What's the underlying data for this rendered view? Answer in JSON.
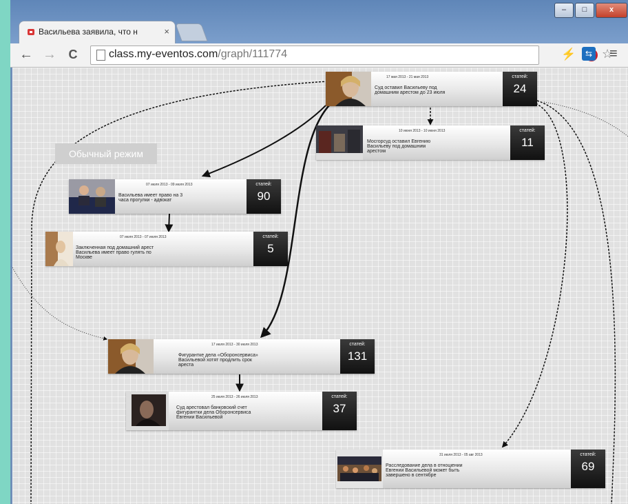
{
  "browser": {
    "tab_title": "Васильева заявила, что н",
    "tab_close": "×",
    "window_buttons": {
      "minimize": "–",
      "maximize": "□",
      "close": "x"
    },
    "nav": {
      "back": "←",
      "forward": "→",
      "reload": "C"
    },
    "url_host": "class.my-eventos.com",
    "url_path": "/graph/111774",
    "adblock_badge": "ABP",
    "star_icon": "☆",
    "ext1_icon": "⚡",
    "ext2_icon": "⇆",
    "menu_icon": "≡"
  },
  "page": {
    "mode_button": "Обычный режим",
    "count_label": "статей:",
    "nodes": [
      {
        "date": "17 мая 2013 - 21 мая 2013",
        "text": "Суд оставил Васильеву под домашним арестом до 23 июля",
        "count": "24",
        "photo": "woman-portrait"
      },
      {
        "date": "10 июня 2013 - 10 июня 2013",
        "text": "Мосгорсуд оставил Евгению Васильеву под домашним арестом",
        "count": "11",
        "photo": "court-scene"
      },
      {
        "date": "07 июля 2013 - 09 июля 2013",
        "text": "Васильева имеет право на 3 часа прогулки - адвокат",
        "count": "90",
        "photo": "courtroom-people"
      },
      {
        "date": "07 июля 2013 - 07 июля 2013",
        "text": "Заключенная под домашний арест Васильева имеет право гулять по Москве",
        "count": "5",
        "photo": "woman-doorway"
      },
      {
        "date": "17 июля 2013 - 30 июля 2013",
        "text": "Фигурантке дела «Оборонсервиса» Васильевой хотят продлить срок ареста",
        "count": "131",
        "photo": "woman-portrait"
      },
      {
        "date": "25 июля 2013 - 26 июля 2013",
        "text": "Суд арестовал банковский счет фигурантки дела Оборонсервиса Евгении Васильевой",
        "count": "37",
        "photo": "woman-dark"
      },
      {
        "date": "31 июля 2013 - 05 авг 2013",
        "text": "Расследование дела в отношении Евгении Васильевой может быть завершено в сентябре",
        "count": "69",
        "photo": "crowd-night"
      }
    ]
  }
}
